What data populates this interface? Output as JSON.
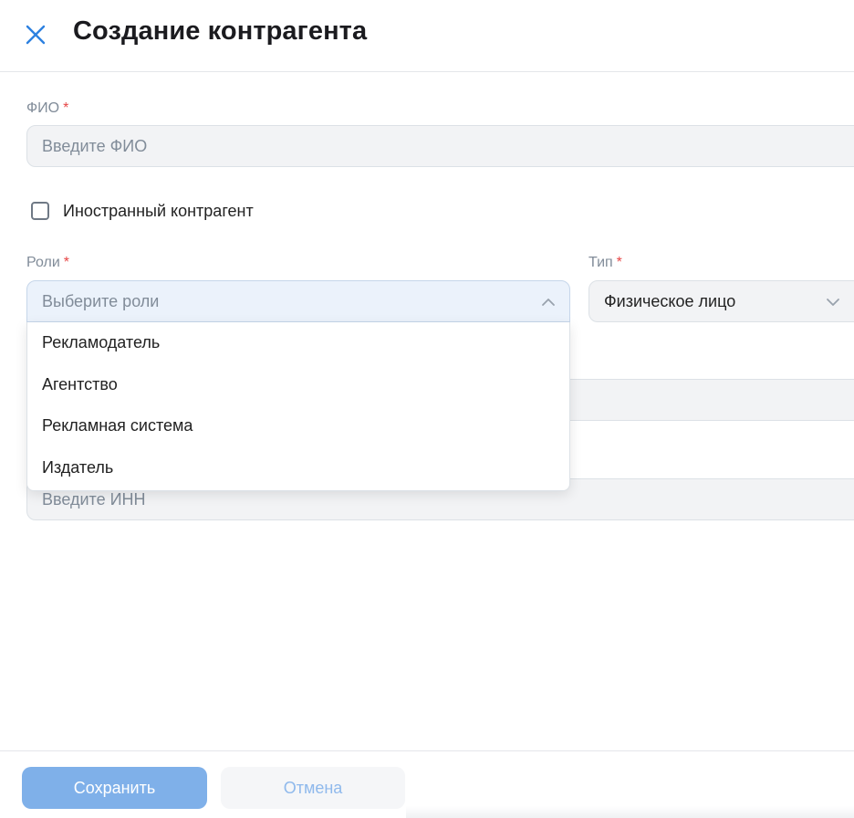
{
  "header": {
    "title": "Создание контрагента",
    "close_icon": "close-icon"
  },
  "form": {
    "fio": {
      "label": "ФИО",
      "required_mark": "*",
      "placeholder": "Введите ФИО",
      "value": ""
    },
    "foreign": {
      "label": "Иностранный контрагент",
      "checked": false
    },
    "roles": {
      "label": "Роли",
      "required_mark": "*",
      "placeholder": "Выберите роли",
      "expanded": true,
      "options": [
        "Рекламодатель",
        "Агентство",
        "Рекламная система",
        "Издатель"
      ]
    },
    "type": {
      "label": "Тип",
      "required_mark": "*",
      "value": "Физическое лицо"
    },
    "hidden_field": {
      "value": ""
    },
    "inn": {
      "placeholder": "Введите ИНН",
      "value": ""
    }
  },
  "footer": {
    "save_label": "Сохранить",
    "cancel_label": "Отмена"
  },
  "colors": {
    "accent": "#2d81e0",
    "save_button": "#7fb0e9",
    "required": "#e64646",
    "input_bg": "#f2f3f5"
  }
}
